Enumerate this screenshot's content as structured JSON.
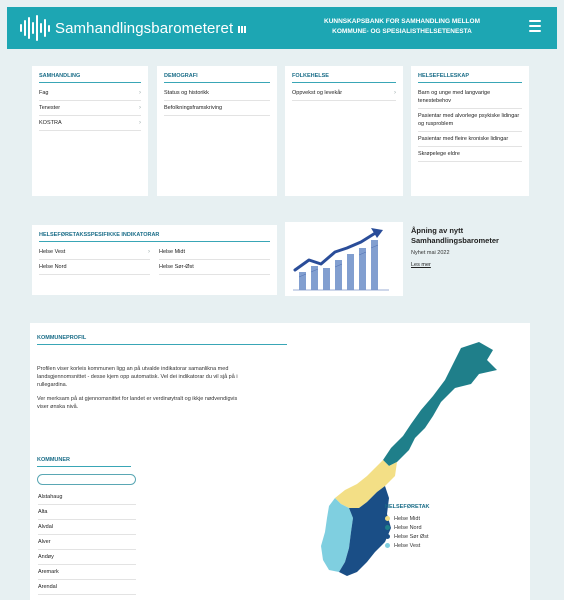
{
  "header": {
    "logo_text": "Samhandlingsbarometeret",
    "tagline_line1": "KUNNSKAPSBANK FOR SAMHANDLING MELLOM",
    "tagline_line2": "KOMMUNE- OG SPESIALISTHELSETENESTA",
    "menu_icon": "hamburger-menu-icon"
  },
  "cards": {
    "samhandling": {
      "title": "SAMHANDLING",
      "items": [
        {
          "label": "Fag",
          "chevron": "›"
        },
        {
          "label": "Tenester",
          "chevron": "›"
        },
        {
          "label": "KOSTRA",
          "chevron": "›"
        }
      ]
    },
    "demografi": {
      "title": "DEMOGRAFI",
      "items": [
        {
          "label": "Status og historikk"
        },
        {
          "label": "Befolkningsframskriving"
        }
      ]
    },
    "folkehelse": {
      "title": "FOLKEHELSE",
      "items": [
        {
          "label": "Oppvekst og levekår",
          "chevron": "›"
        }
      ]
    },
    "helsefelleskap": {
      "title": "HELSEFELLESKAP",
      "items": [
        {
          "label": "Barn og unge med langvarige tenestebehov"
        },
        {
          "label": "Pasientar med alvorlege psykiske lidingar og rusproblem"
        },
        {
          "label": "Pasientar med fleire kroniske lidingar"
        },
        {
          "label": "Skrøpelege eldre"
        }
      ]
    },
    "foretak": {
      "title": "HELSEFØRETAKSSPESIFIKKE INDIKATORAR",
      "items": [
        {
          "label": "Helse Vest",
          "chevron": "›"
        },
        {
          "label": "Helse Midt"
        },
        {
          "label": "Helse Nord"
        },
        {
          "label": "Helse Sør-Øst"
        }
      ]
    }
  },
  "news": {
    "title": "Åpning av nytt Samhandlingsbarometer",
    "meta": "Nyhet mai 2022",
    "link": "Les mer"
  },
  "profile": {
    "title": "KOMMUNEPROFIL",
    "paragraph1": "Profilen viser korleis kommunen ligg an på utvalde indikatorar samanlikna med landsgjennomsnittet - desse kjem opp automatisk. Vel dei indikatorar du vil sjå på i rullegardina.",
    "paragraph2": "Ver merksam på at gjennomsnittet for landet er verdinøytralt og ikkje nødvendigvis viser ønska nivå.",
    "kommuner_title": "KOMMUNER",
    "search_value": "",
    "kommuner": [
      "Alstahaug",
      "Alta",
      "Alvdal",
      "Alver",
      "Andøy",
      "Aremark",
      "Arendal"
    ]
  },
  "legend": {
    "title": "HELSEFØRETAK",
    "items": [
      {
        "label": "Helse Midt",
        "color": "#f3df86"
      },
      {
        "label": "Helse Nord",
        "color": "#1f7f8a"
      },
      {
        "label": "Helse Sør Øst",
        "color": "#1a4e86"
      },
      {
        "label": "Helse Vest",
        "color": "#7fcfe0"
      }
    ]
  }
}
